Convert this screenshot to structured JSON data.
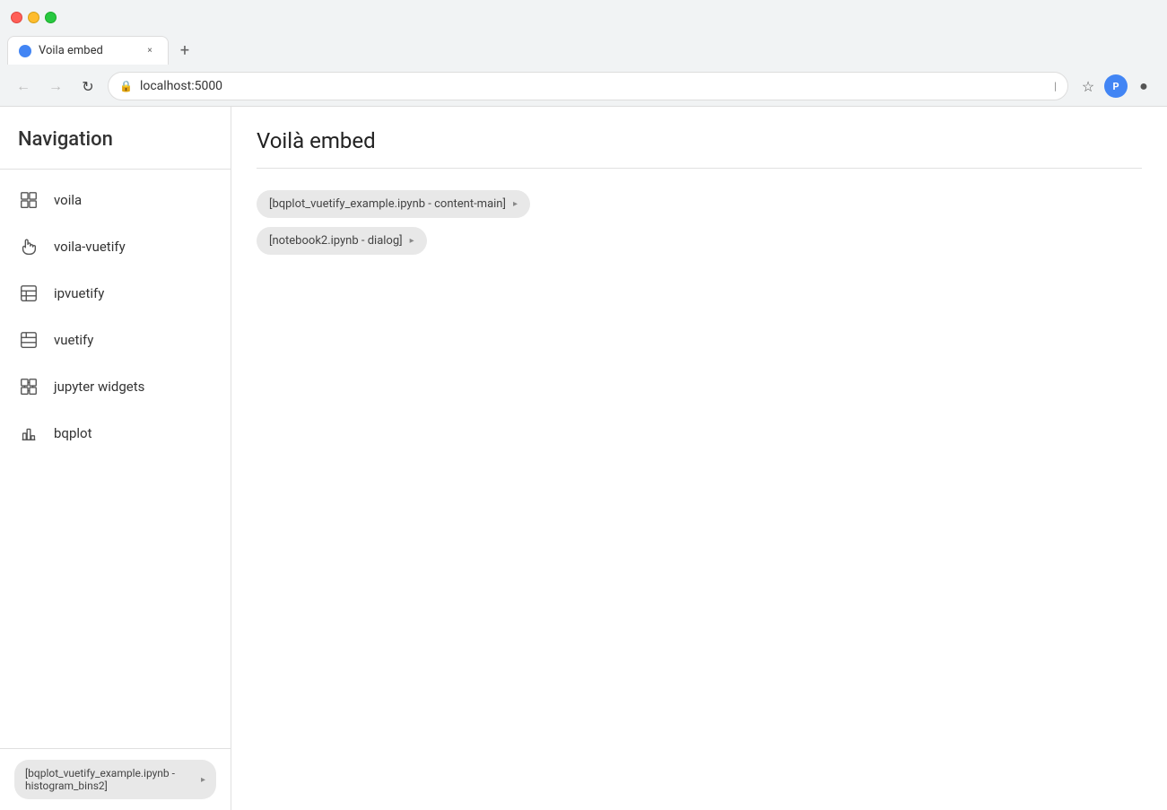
{
  "browser": {
    "tab_label": "Voila embed",
    "address": "localhost:5000",
    "new_tab_symbol": "+",
    "tab_close_symbol": "×"
  },
  "sidebar": {
    "title": "Navigation",
    "items": [
      {
        "id": "voila",
        "label": "voila",
        "icon": "grid"
      },
      {
        "id": "voila-vuetify",
        "label": "voila-vuetify",
        "icon": "hand"
      },
      {
        "id": "ipvuetify",
        "label": "ipvuetify",
        "icon": "table"
      },
      {
        "id": "vuetify",
        "label": "vuetify",
        "icon": "table2"
      },
      {
        "id": "jupyter-widgets",
        "label": "jupyter widgets",
        "icon": "puzzle"
      },
      {
        "id": "bqplot",
        "label": "bqplot",
        "icon": "bar-chart"
      }
    ],
    "footer_chip": {
      "label": "[bqplot_vuetify_example.ipynb - histogram_bins2]",
      "arrow": "▸"
    }
  },
  "main": {
    "title": "Voilà embed",
    "chips": [
      {
        "label": "[bqplot_vuetify_example.ipynb - content-main]",
        "arrow": "▸"
      },
      {
        "label": "[notebook2.ipynb - dialog]",
        "arrow": "▸"
      }
    ]
  }
}
